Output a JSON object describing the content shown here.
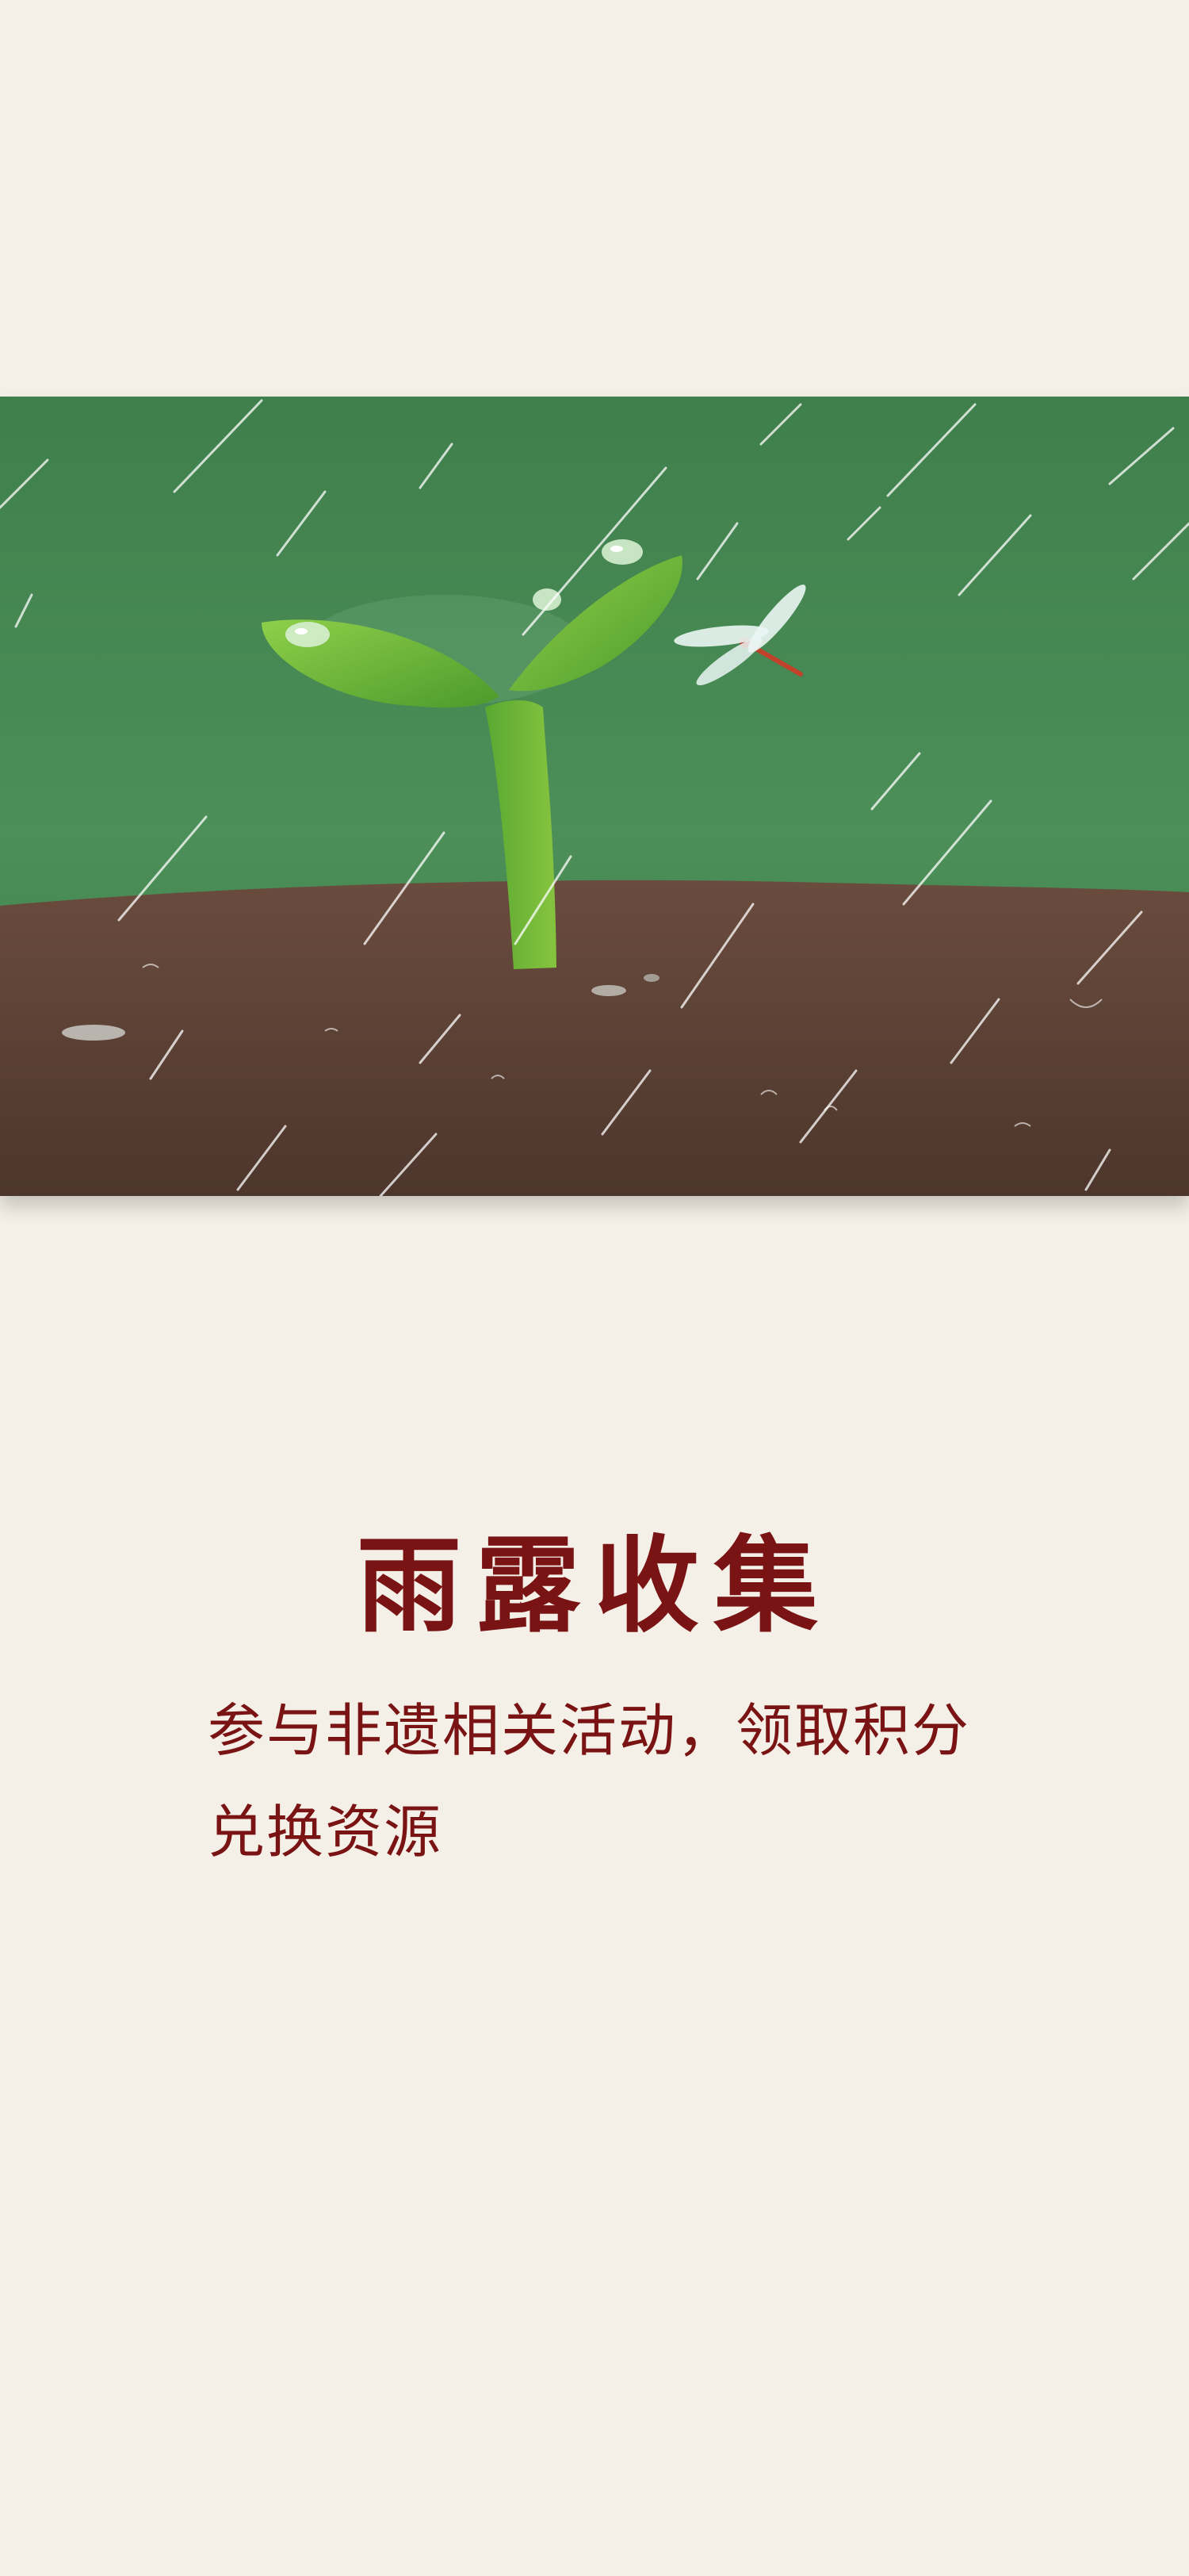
{
  "theme": {
    "background": "#f4f0e7",
    "accent": "#7a1414"
  },
  "illustration": {
    "icon": "sprout-in-rain-illustration"
  },
  "content": {
    "title": "雨露收集",
    "description": "参与非遗相关活动，领取积分兑换资源"
  }
}
